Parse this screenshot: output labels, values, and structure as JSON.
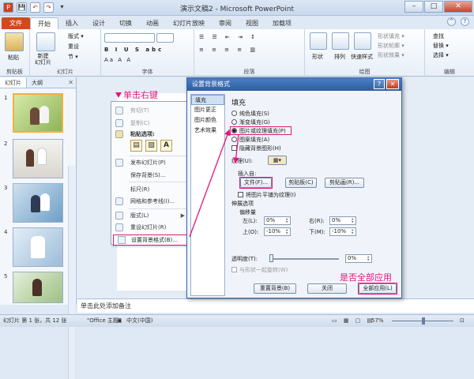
{
  "window": {
    "title": "演示文稿2 - Microsoft PowerPoint",
    "qat": [
      "P",
      "💾",
      "↶",
      "↷",
      "▾"
    ],
    "min": "–",
    "max": "□",
    "close": "✕"
  },
  "tabs": [
    "文件",
    "开始",
    "插入",
    "设计",
    "切换",
    "动画",
    "幻灯片放映",
    "审阅",
    "视图",
    "加载项"
  ],
  "ribbon": {
    "paste": "粘贴",
    "new_slide": "新建\n幻灯片",
    "layout": "版式 ▾",
    "reset": "重设",
    "section": "节 ▾",
    "groups": [
      "剪贴板",
      "幻灯片",
      "字体",
      "段落",
      "绘图",
      "编辑"
    ],
    "shape": "形状",
    "arrange": "排列",
    "quick_style": "快速样式",
    "shape_fill": "形状填充 ▾",
    "shape_outline": "形状轮廓 ▾",
    "shape_effect": "形状效果 ▾",
    "find": "查找",
    "replace": "替换 ▾",
    "select": "选择 ▾"
  },
  "left_pane": {
    "tabs": [
      "幻灯片",
      "大纲"
    ],
    "close": "✕",
    "slides": [
      "1",
      "2",
      "3",
      "4",
      "5"
    ]
  },
  "annotations": {
    "right_click": "单击右键",
    "apply_all": "是否全部应用"
  },
  "context_menu": {
    "cut": "剪切(T)",
    "copy": "复制(C)",
    "paste_options": "粘贴选项:",
    "publish": "发布幻灯片(P)",
    "save_as_picture": "保存背景(S)...",
    "ruler": "标尺(R)",
    "grid": "网格和参考线(I)...",
    "layout": "版式(L)",
    "reset": "重设幻灯片(R)",
    "format_background": "设置背景格式(B)...",
    "arrow": "▶"
  },
  "dialog": {
    "title": "设置背景格式",
    "help": "?",
    "close": "✕",
    "categories": [
      "填充",
      "图片更正",
      "图片颜色",
      "艺术效果"
    ],
    "section": "填充",
    "fill_options": [
      "纯色填充(S)",
      "渐变填充(G)",
      "图片或纹理填充(P)",
      "图案填充(A)"
    ],
    "hide_bg": "隐藏背景图形(H)",
    "texture": "纹理(U):",
    "insert_from": "插入自:",
    "file_btn": "文件(F)...",
    "clipboard_btn": "剪贴板(C)",
    "clipart_btn": "剪贴画(R)...",
    "tile": "将图片平铺为纹理(I)",
    "stretch": "伸展选项",
    "offsets": "偏移量",
    "left_l": "左(L):",
    "left_v": "0%",
    "right_l": "右(R):",
    "right_v": "0%",
    "top_l": "上(O):",
    "top_v": "-10%",
    "bottom_l": "下(M):",
    "bottom_v": "-10%",
    "transparency": "透明度(T):",
    "transparency_v": "0%",
    "rotate": "与形状一起旋转(W)",
    "reset_btn": "重置背景(B)",
    "close_btn": "关闭",
    "apply_all_btn": "全部应用(L)"
  },
  "notes": "单击此处添加备注",
  "status": {
    "slide": "幻灯片 第 1 张，共 12 张",
    "theme": "\"Office 主题\"",
    "lang": "中文(中国)",
    "zoom": "57%"
  }
}
